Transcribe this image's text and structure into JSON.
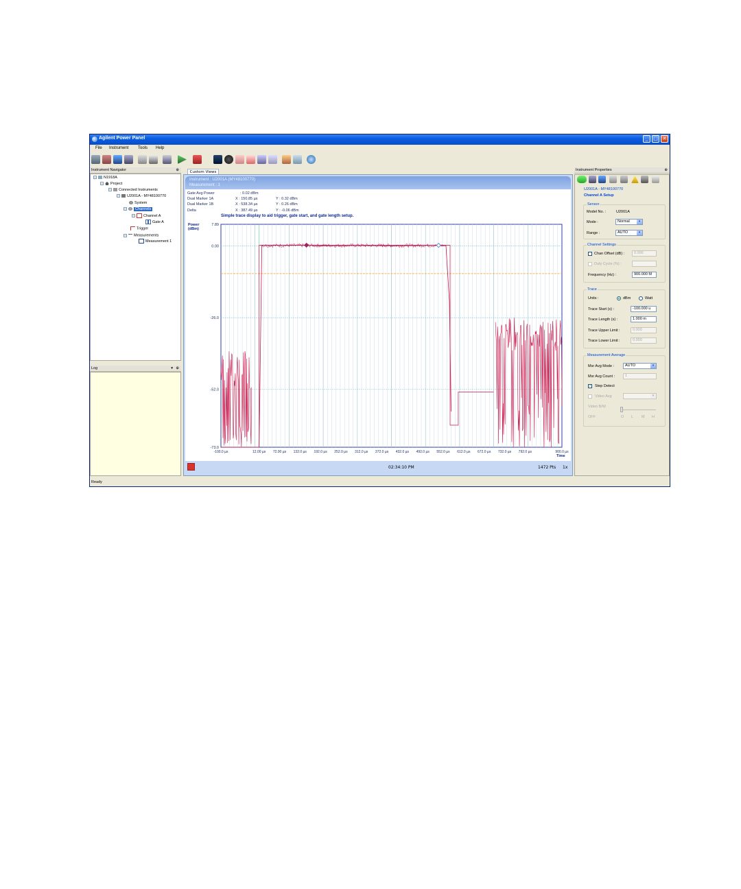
{
  "window": {
    "title": "Agilent Power Panel",
    "controls": [
      "minimize",
      "maximize",
      "close"
    ]
  },
  "menu": [
    "File",
    "Instrument",
    "Tools",
    "Help"
  ],
  "navigator": {
    "header": "Instrument Navigator",
    "pin": "1",
    "tree": [
      {
        "label": "N1918A",
        "level": 0
      },
      {
        "label": "Project",
        "level": 1
      },
      {
        "label": "Connected Instruments",
        "level": 2
      },
      {
        "label": "U2001A - MY48100770",
        "level": 3
      },
      {
        "label": "System",
        "level": 4
      },
      {
        "label": "Channels",
        "level": 4,
        "selected": true
      },
      {
        "label": "Channel A",
        "level": 5
      },
      {
        "label": "Gate A",
        "level": 6
      },
      {
        "label": "Trigger",
        "level": 4
      },
      {
        "label": "Measurements",
        "level": 4
      },
      {
        "label": "Measurement 1",
        "level": 5
      }
    ]
  },
  "log": {
    "header": "Log"
  },
  "tab": {
    "label": "Custom Views"
  },
  "instrument_header": {
    "line1": "Instrument : U2001A (MY48100770)",
    "line2": "Measurement : 1"
  },
  "readouts": {
    "gate_avg_power_label": "Gate Avg Power",
    "gate_avg_power_value": ": 0.02 dBm",
    "dual_marker_1a_label": "Dual Marker 1A",
    "dual_marker_1a_x": "X : 150.85 µs",
    "dual_marker_1a_y": "Y : 0.32 dBm",
    "dual_marker_1b_label": "Dual Marker 1B",
    "dual_marker_1b_x": "X : 538.34 µs",
    "dual_marker_1b_y": "Y : 0.26 dBm",
    "delta_label": "Delta",
    "delta_x": "X : 387.49 µs",
    "delta_y": "Y : -0.06 dBm",
    "annotation": "Simple trace display to aid trigger, gate start, and gate length setup."
  },
  "chart_data": {
    "type": "line",
    "ylabel": "Power\n(dBm)",
    "xlabel": "Time",
    "yticks": [
      "7.89",
      "0.00",
      "-26.0",
      "-52.0",
      "-73.0"
    ],
    "ylim": [
      -73.0,
      7.89
    ],
    "xticks": [
      "-100.0 µs",
      "12.00 µs",
      "72.00 µs",
      "132.0 µs",
      "192.0 µs",
      "252.0 µs",
      "312.0 µs",
      "372.0 µs",
      "432.0 µs",
      "492.0 µs",
      "552.0 µs",
      "612.0 µs",
      "672.0 µs",
      "732.0 µs",
      "792.0 µs",
      "900.0 µs"
    ],
    "xlim": [
      -100.0,
      900.0
    ],
    "gate_level_dbm": -10.0,
    "markers": [
      {
        "name": "1A",
        "x": 150.85,
        "y": 0.32
      },
      {
        "name": "1B",
        "x": 538.34,
        "y": 0.26
      }
    ],
    "series": [
      {
        "color": "#c8164a",
        "segments": [
          {
            "x": [
              -100,
              12,
              20,
              30,
              40,
              60,
              100,
              150,
              200,
              300,
              400,
              500,
              538,
              560,
              570,
              575
            ],
            "y": [
              -73,
              -73,
              0.3,
              0.3,
              0.3,
              0.3,
              0.2,
              0.3,
              0.1,
              0.2,
              0.1,
              0.2,
              0.3,
              0.1,
              -20,
              -60
            ]
          }
        ],
        "gate_profile": {
          "x": [
            12,
            12,
            552,
            572,
            572,
            596,
            596,
            700
          ],
          "y": [
            -73,
            0.3,
            0.3,
            0.3,
            -65,
            -65,
            -53,
            -53
          ]
        }
      }
    ]
  },
  "bottom_bar": {
    "time": "02:34:10 PM",
    "points": "1472 Pts",
    "zoom": "1x"
  },
  "properties": {
    "header": "Instrument Properties",
    "device": "U2001A - MY48100770",
    "setup_title": "Channel A Setup",
    "sensor": {
      "title": "Sensor",
      "model_label": "Model No. :",
      "model_value": "U2001A",
      "mode_label": "Mode :",
      "mode_value": "Normal",
      "range_label": "Range :",
      "range_value": "AUTO"
    },
    "channel_settings": {
      "title": "Channel Settings",
      "chan_offset_label": "Chan Offset (dB) :",
      "chan_offset_value": "0.000",
      "duty_cycle_label": "Duty Cycle (%) :",
      "frequency_label": "Frequency (Hz) :",
      "frequency_value": "900.000 M"
    },
    "trace": {
      "title": "Trace",
      "units_label": "Units :",
      "unit_dbm": "dBm",
      "unit_watt": "Watt",
      "trace_start_label": "Trace Start (s) :",
      "trace_start_value": "-100.000 u",
      "trace_length_label": "Trace Length (s) :",
      "trace_length_value": "1.000 m",
      "trace_upper_label": "Trace Upper Limit :",
      "trace_upper_value": "0.000",
      "trace_lower_label": "Trace Lower Limit :",
      "trace_lower_value": "0.000"
    },
    "measurement_average": {
      "title": "Measurement Average",
      "mode_label": "Msr Avg Mode :",
      "mode_value": "AUTO",
      "count_label": "Msr Avg Count :",
      "count_value": "1",
      "step_detect_label": "Step Detect",
      "video_avg_label": "Video Avg",
      "video_bw_label": "Video B/W",
      "off_label": "OFF",
      "scale": [
        "O",
        "L",
        "M",
        "H"
      ]
    }
  },
  "status": "Ready"
}
